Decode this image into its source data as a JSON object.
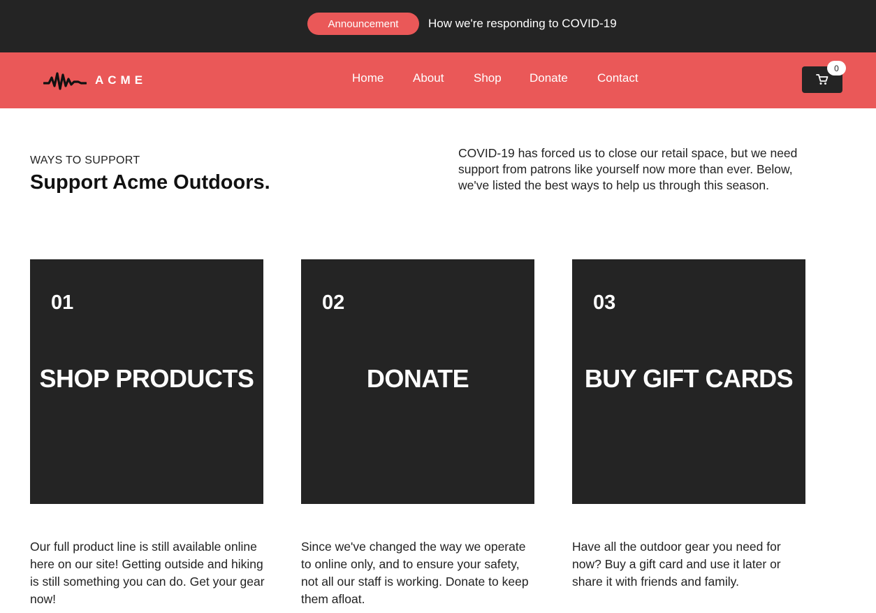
{
  "announcement": {
    "pill_label": "Announcement",
    "text": "How we're responding to COVID-19"
  },
  "header": {
    "logo_text": "ACME",
    "logo_icon": "sound-wave-icon",
    "nav": [
      {
        "label": "Home"
      },
      {
        "label": "About"
      },
      {
        "label": "Shop"
      },
      {
        "label": "Donate"
      },
      {
        "label": "Contact"
      }
    ],
    "cart_icon": "shopping-cart-icon",
    "cart_count": "0"
  },
  "intro": {
    "eyebrow": "WAYS TO SUPPORT",
    "title": "Support Acme Outdoors.",
    "copy": "COVID-19 has forced us to close our retail space, but we need support from patrons like yourself now more than ever. Below, we've listed the best ways to help us through this season."
  },
  "cards": [
    {
      "number": "01",
      "title": "SHOP PRODUCTS",
      "description": "Our full product line is still available online here on our site! Getting outside and hiking is still something you can do. Get your gear now!"
    },
    {
      "number": "02",
      "title": "DONATE",
      "description": "Since we've changed the way we operate to online only, and to ensure your safety, not all our staff is working. Donate to keep them afloat."
    },
    {
      "number": "03",
      "title": "BUY GIFT CARDS",
      "description": "Have all the outdoor gear you need for now? Buy a gift card and use it later or share it with friends and family."
    }
  ],
  "colors": {
    "accent": "#ea5858",
    "dark": "#242424",
    "text": "#222222",
    "background": "#ffffff"
  }
}
